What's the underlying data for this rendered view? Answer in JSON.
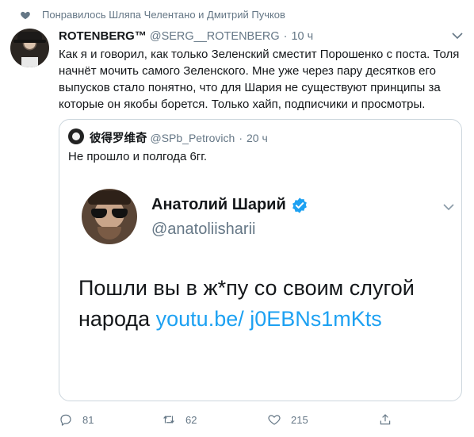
{
  "social_context": {
    "text": "Понравилось Шляпа Челентано и Дмитрий Пучков"
  },
  "tweet": {
    "name": "ROTENBERG™",
    "handle": "@SERG__ROTENBERG",
    "separator": "·",
    "time": "10 ч",
    "text": "Как я и говорил, как только Зеленский сместит Порошенко с поста. Толя начнёт мочить самого Зеленского. Мне уже через пару десятков его выпусков стало понятно, что для Шария не существуют принципы за которые он якобы борется. Только хайп, подписчики и просмотры."
  },
  "quoted": {
    "name": "彼得罗维奇",
    "handle": "@SPb_Petrovich",
    "separator": "·",
    "time": "20 ч",
    "text": "Не прошло и полгода 6гг.",
    "image": {
      "name": "Анатолий Шарий",
      "handle": "@anatoliisharii",
      "text_before_link": "Пошли вы в ж*пу со своим слугой народа ",
      "link": "youtu.be/ j0EBNs1mKts"
    }
  },
  "actions": {
    "replies": "81",
    "retweets": "62",
    "likes": "215"
  },
  "icons": {
    "heart": "heart-icon",
    "caret": "chevron-down-icon",
    "verified": "verified-badge-icon",
    "reply": "reply-icon",
    "retweet": "retweet-icon",
    "like": "like-icon",
    "share": "share-icon"
  },
  "colors": {
    "accent": "#1da1f2",
    "muted": "#657786",
    "border": "#ccd6dd"
  }
}
